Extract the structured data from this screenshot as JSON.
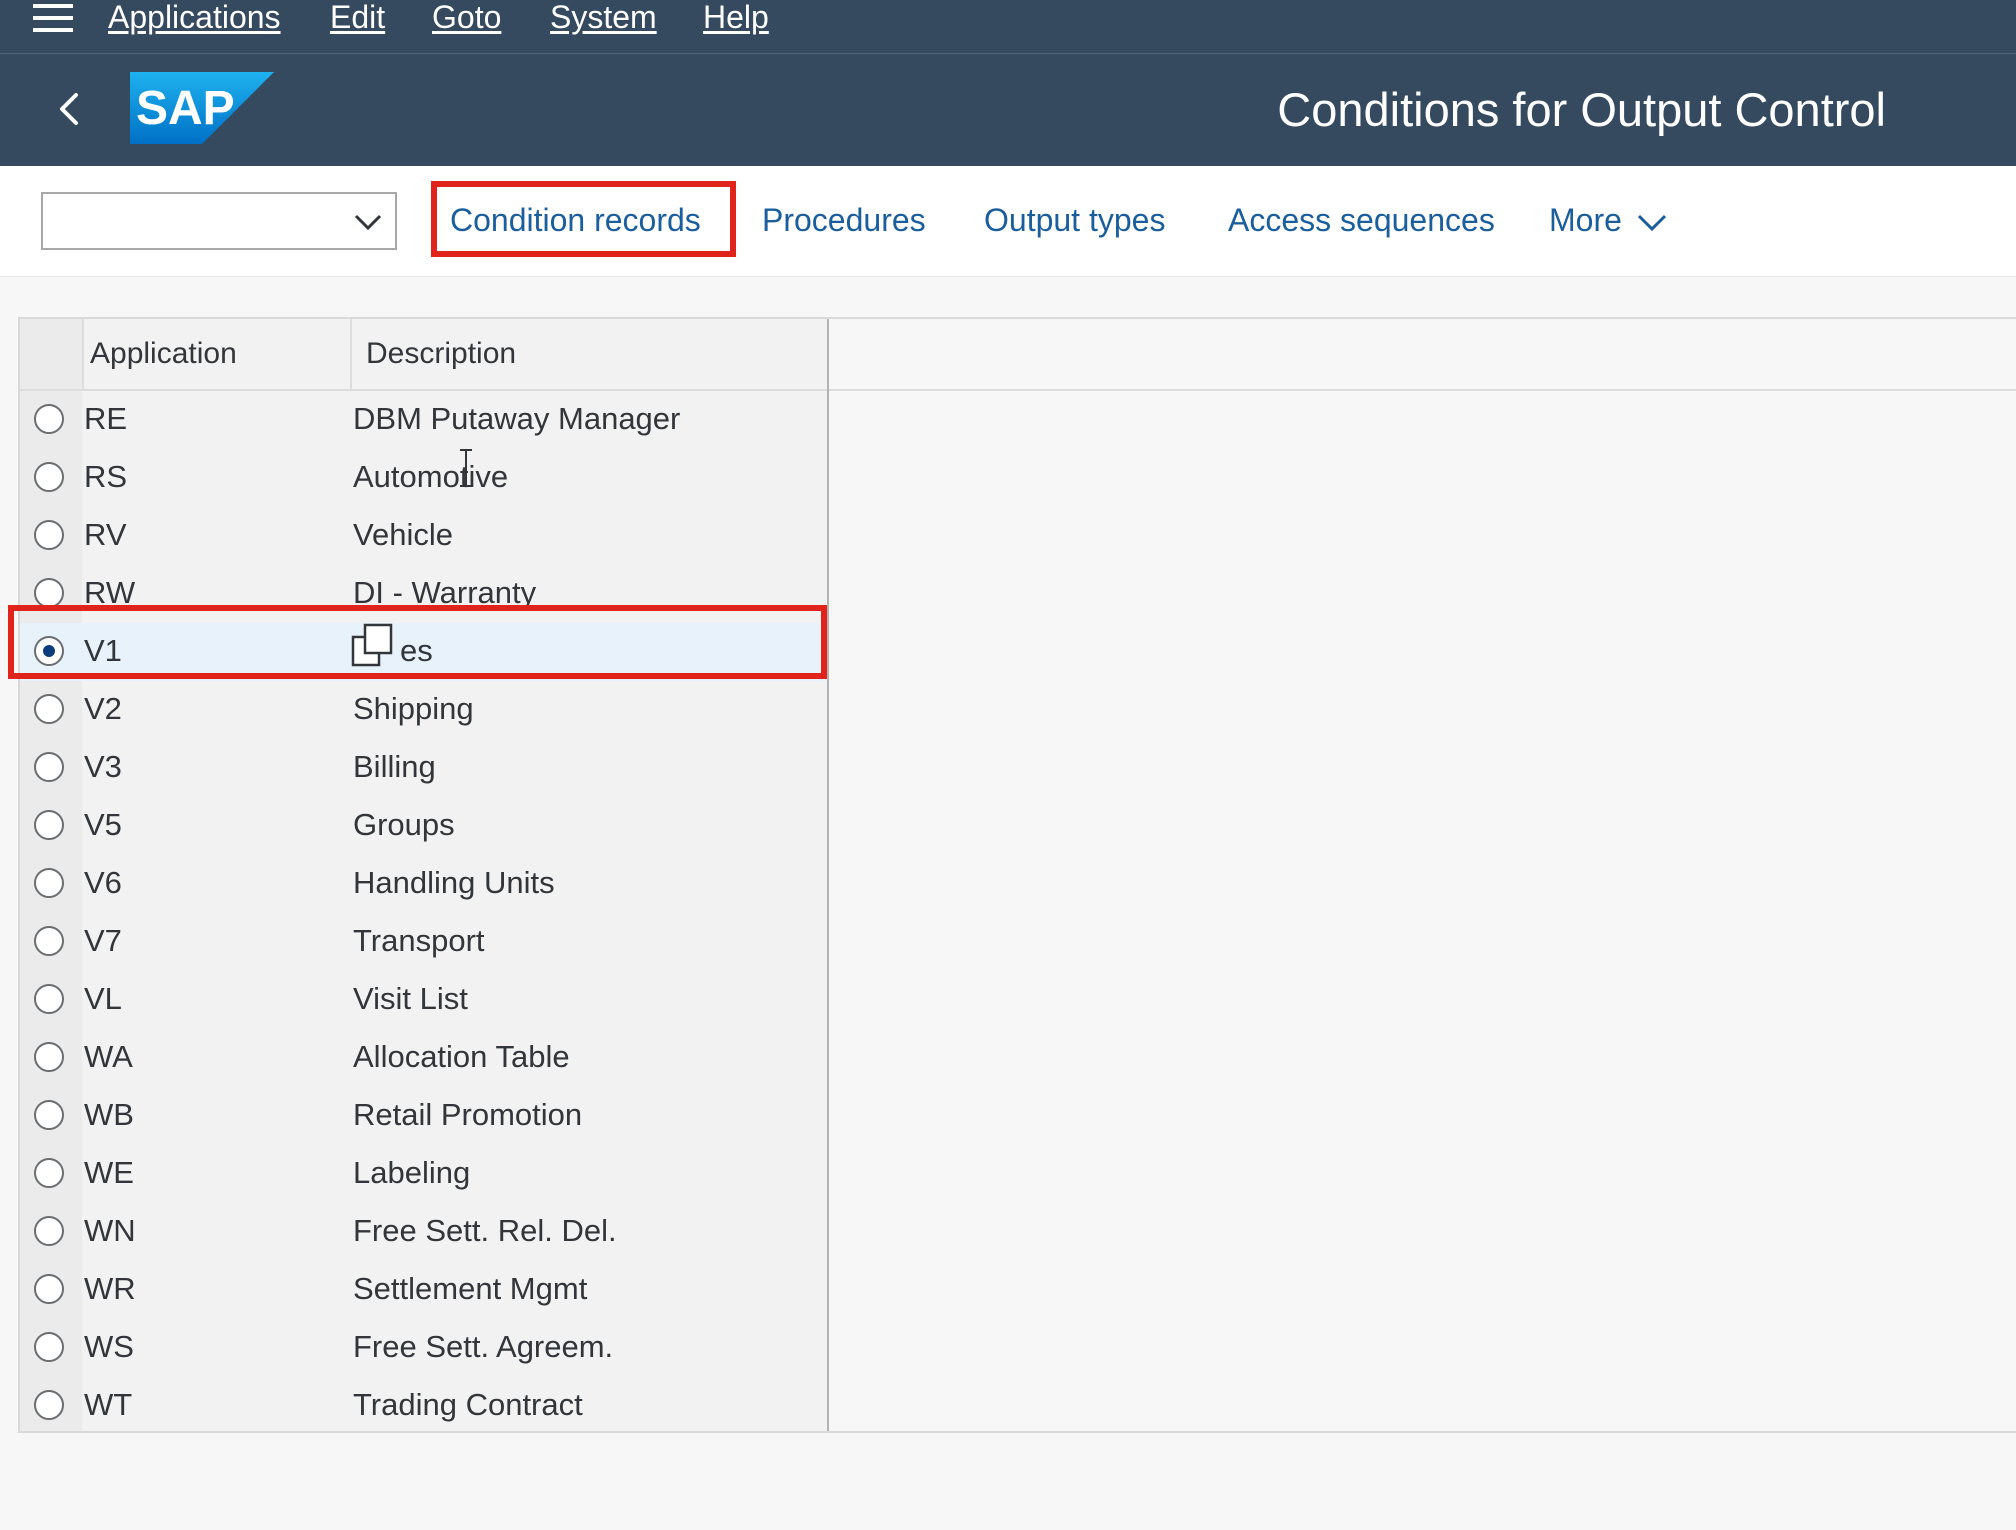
{
  "menubar": {
    "items": [
      "Applications",
      "Edit",
      "Goto",
      "System",
      "Help"
    ]
  },
  "shell": {
    "logo_text": "SAP",
    "title": "Conditions for Output Control"
  },
  "toolbar": {
    "combo_value": "",
    "links": [
      "Condition records",
      "Procedures",
      "Output types",
      "Access sequences"
    ],
    "more_label": "More"
  },
  "table": {
    "headers": {
      "application": "Application",
      "description": "Description"
    },
    "rows": [
      {
        "app": "RE",
        "desc": "DBM Putaway Manager"
      },
      {
        "app": "RS",
        "desc": "Automotive"
      },
      {
        "app": "RV",
        "desc": "Vehicle"
      },
      {
        "app": "RW",
        "desc": "DI - Warranty"
      },
      {
        "app": "V1",
        "desc": "es"
      },
      {
        "app": "V2",
        "desc": "Shipping"
      },
      {
        "app": "V3",
        "desc": "Billing"
      },
      {
        "app": "V5",
        "desc": "Groups"
      },
      {
        "app": "V6",
        "desc": "Handling Units"
      },
      {
        "app": "V7",
        "desc": "Transport"
      },
      {
        "app": "VL",
        "desc": "Visit List"
      },
      {
        "app": "WA",
        "desc": "Allocation Table"
      },
      {
        "app": "WB",
        "desc": "Retail Promotion"
      },
      {
        "app": "WE",
        "desc": "Labeling"
      },
      {
        "app": "WN",
        "desc": "Free Sett. Rel. Del."
      },
      {
        "app": "WR",
        "desc": "Settlement Mgmt"
      },
      {
        "app": "WS",
        "desc": "Free Sett. Agreem."
      },
      {
        "app": "WT",
        "desc": "Trading Contract"
      }
    ],
    "selected_app": "V1"
  },
  "colors": {
    "shell_bg": "#354a5f",
    "link": "#1b5e9c",
    "highlight": "#e0231b",
    "selected_row": "#e8f2fb"
  }
}
